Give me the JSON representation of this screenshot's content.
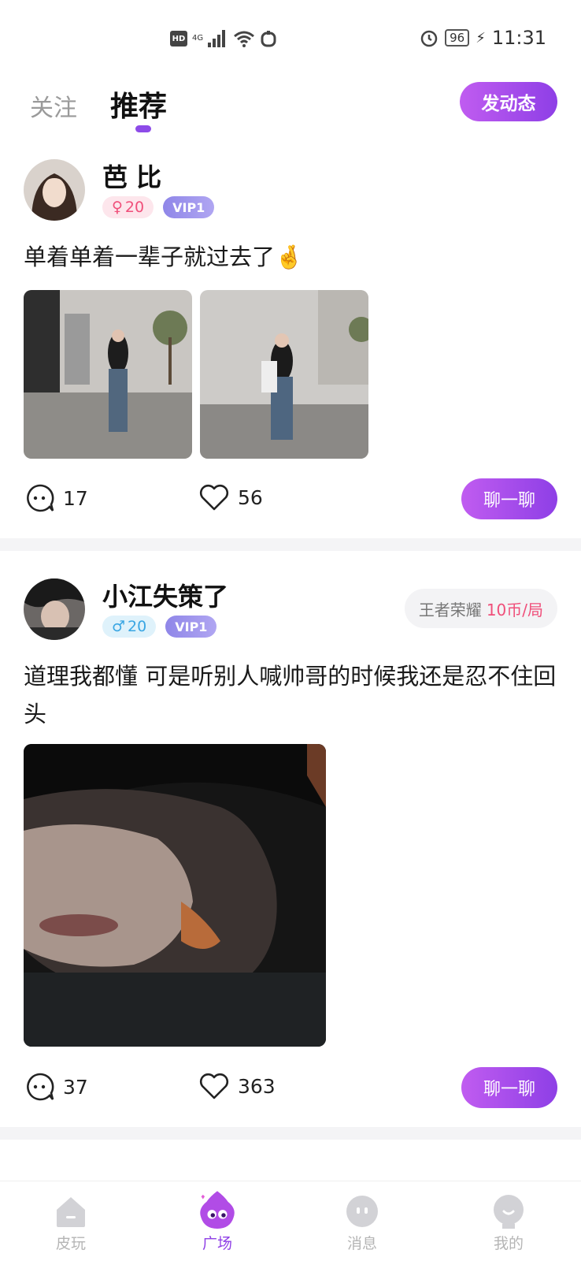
{
  "status_bar": {
    "hd": "HD",
    "network": "4G",
    "battery": "96",
    "time": "11:31"
  },
  "header": {
    "tab_follow": "关注",
    "tab_recommend": "推荐",
    "publish_button": "发动态"
  },
  "posts": [
    {
      "username": "芭 比",
      "gender_symbol": "♀",
      "age": "20",
      "vip": "VIP1",
      "content": "单着单着一辈子就过去了🤞",
      "comments": "17",
      "likes": "56",
      "chat_button": "聊一聊"
    },
    {
      "username": "小江失策了",
      "gender_symbol": "♂",
      "age": "20",
      "vip": "VIP1",
      "game_name": "王者荣耀",
      "game_price": "10币/局",
      "content": "道理我都懂  可是听别人喊帅哥的时候我还是忍不住回头",
      "comments": "37",
      "likes": "363",
      "chat_button": "聊一聊"
    }
  ],
  "bottom_nav": {
    "items": [
      {
        "label": "皮玩",
        "icon": "home-icon"
      },
      {
        "label": "广场",
        "icon": "plaza-icon"
      },
      {
        "label": "消息",
        "icon": "message-icon"
      },
      {
        "label": "我的",
        "icon": "profile-icon"
      }
    ]
  },
  "colors": {
    "accent": "#9040e6",
    "female": "#f04f7a",
    "male": "#3aa6e3",
    "vip": "#9b91ec"
  }
}
